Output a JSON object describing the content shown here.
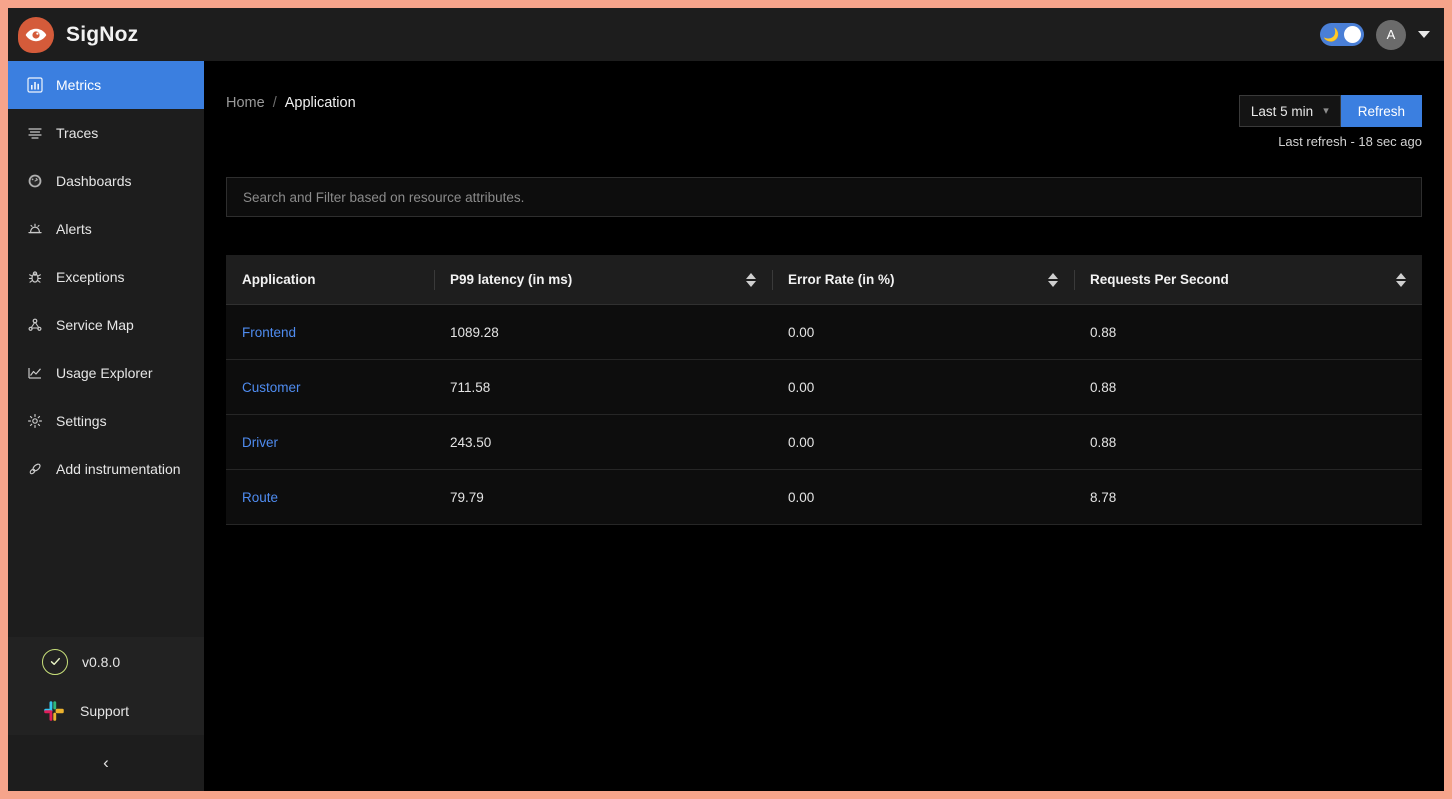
{
  "brand": {
    "name": "SigNoz",
    "logo_icon": "eye-icon",
    "logo_color": "#d45b3a"
  },
  "topbar": {
    "theme_toggle": {
      "icon": "moon-icon",
      "state": "dark",
      "color": "#4a7fd6"
    },
    "avatar_initial": "A",
    "account_caret_icon": "caret-down-icon"
  },
  "sidebar": {
    "items": [
      {
        "label": "Metrics",
        "icon": "bar-chart-icon",
        "active": true
      },
      {
        "label": "Traces",
        "icon": "list-lines-icon",
        "active": false
      },
      {
        "label": "Dashboards",
        "icon": "gauge-icon",
        "active": false
      },
      {
        "label": "Alerts",
        "icon": "alarm-icon",
        "active": false
      },
      {
        "label": "Exceptions",
        "icon": "bug-icon",
        "active": false
      },
      {
        "label": "Service Map",
        "icon": "node-graph-icon",
        "active": false
      },
      {
        "label": "Usage Explorer",
        "icon": "line-chart-icon",
        "active": false
      },
      {
        "label": "Settings",
        "icon": "gear-icon",
        "active": false
      },
      {
        "label": "Add instrumentation",
        "icon": "rocket-icon",
        "active": false
      }
    ],
    "version": {
      "label": "v0.8.0",
      "icon": "check-circle-icon",
      "color": "#c8e07a"
    },
    "support": {
      "label": "Support",
      "icon": "slack-icon"
    },
    "collapse": {
      "icon": "chevron-left-icon"
    },
    "active_color": "#3b7fe0"
  },
  "main": {
    "breadcrumb": {
      "home": "Home",
      "separator": "/",
      "current": "Application"
    },
    "time_range": {
      "selected": "Last 5 min",
      "chevron_icon": "chevron-down-icon"
    },
    "refresh_button": "Refresh",
    "last_refresh": "Last refresh - 18 sec ago",
    "search": {
      "placeholder": "Search and Filter based on resource attributes.",
      "value": ""
    }
  },
  "table": {
    "columns": [
      {
        "label": "Application",
        "sortable": false
      },
      {
        "label": "P99 latency (in ms)",
        "sortable": true
      },
      {
        "label": "Error Rate (in %)",
        "sortable": true
      },
      {
        "label": "Requests Per Second",
        "sortable": true
      }
    ],
    "rows": [
      {
        "application": "Frontend",
        "p99_latency": "1089.28",
        "error_rate": "0.00",
        "rps": "0.88"
      },
      {
        "application": "Customer",
        "p99_latency": "711.58",
        "error_rate": "0.00",
        "rps": "0.88"
      },
      {
        "application": "Driver",
        "p99_latency": "243.50",
        "error_rate": "0.00",
        "rps": "0.88"
      },
      {
        "application": "Route",
        "p99_latency": "79.79",
        "error_rate": "0.00",
        "rps": "8.78"
      }
    ],
    "link_color": "#4f8cf0"
  }
}
